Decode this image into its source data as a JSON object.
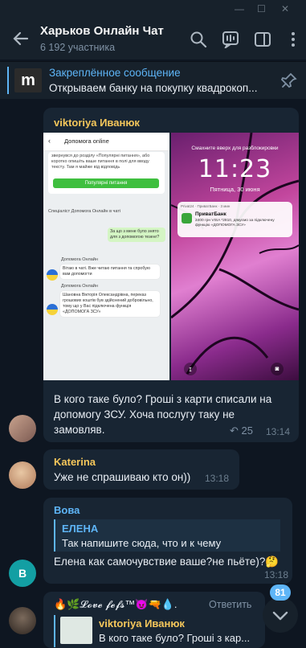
{
  "header": {
    "title": "Харьков Онлайн Чат",
    "subtitle": "6 192 участника"
  },
  "pinned": {
    "title": "Закреплённое сообщение",
    "text": "Открываем банку на покупку квадрокоп...",
    "logo": "m"
  },
  "messages": [
    {
      "sender": "viktoriya Иванюк",
      "sender_color": "#f5c75b",
      "text_lines": [
        "В кого таке було? Гроші з карти списали на",
        "допомогу ЗСУ. Хоча послугу таку не",
        "замовляв."
      ],
      "replies": "25",
      "time": "13:14",
      "screenshot_left": {
        "header": "Допомога online",
        "intro": "звернувся до розділу «Популярні питання», або коротко опишіть ваше питання в полі для вводу тексту. Там я майже від відповідь",
        "button": "Популярні питання",
        "specialist": "Спеціаліст Допомога Онлайн в чаті",
        "user_msg": "За що з мене було знято для з допомогою тезенг?",
        "bot_name": "Допомога Онлайн",
        "bot_msg1": "Вітаю в чаті. Вже читаю питання та спробую вам допомогти",
        "bot_msg2": "Шановна Вікторія Олександрівна, переказ грошових коштів був здійснений добровільно, тому що у Вас підключена функція «ДОПОМОГА ЗСУ»"
      },
      "screenshot_right": {
        "hint": "Смахните вверх для разблокировки",
        "clock": "11:23",
        "date": "Пятница, 30 июня",
        "notif_top": "Privat24 · ПриватБанк · 3 мин",
        "notif_title": "ПриватБанк",
        "notif_text": "2400 грн VISA *2810, дякуємо за підключену функцію «ДОПОМОГА ЗСУ»"
      }
    },
    {
      "sender": "Katerina",
      "sender_color": "#f5c75b",
      "text": "Уже не спрашиваю кто он))",
      "time": "13:18"
    },
    {
      "sender": "Вова",
      "sender_color": "#5eb5f7",
      "avatar_letter": "B",
      "quote_name": "ЕЛЕНА",
      "quote_text": "Так напишите сюда,  что и к чему",
      "text": "Елена как самочувствие ваше?не пьёте)?🤔",
      "time": "13:18"
    },
    {
      "sender": "🔥🌿𝓛𝓸𝓿𝓮 𝓯𝓮𝓯𝓼™😈🔫💧.",
      "sender_color": "#e9eef4",
      "reply_action": "Ответить",
      "quote_name": "viktoriya Иванюк",
      "quote_text": "В кого таке було? Гроші з кар..."
    }
  ],
  "scroll": {
    "badge": "81"
  },
  "colors": {
    "accent": "#5eb5f7",
    "bubble": "#182533",
    "background": "#0e1621"
  }
}
